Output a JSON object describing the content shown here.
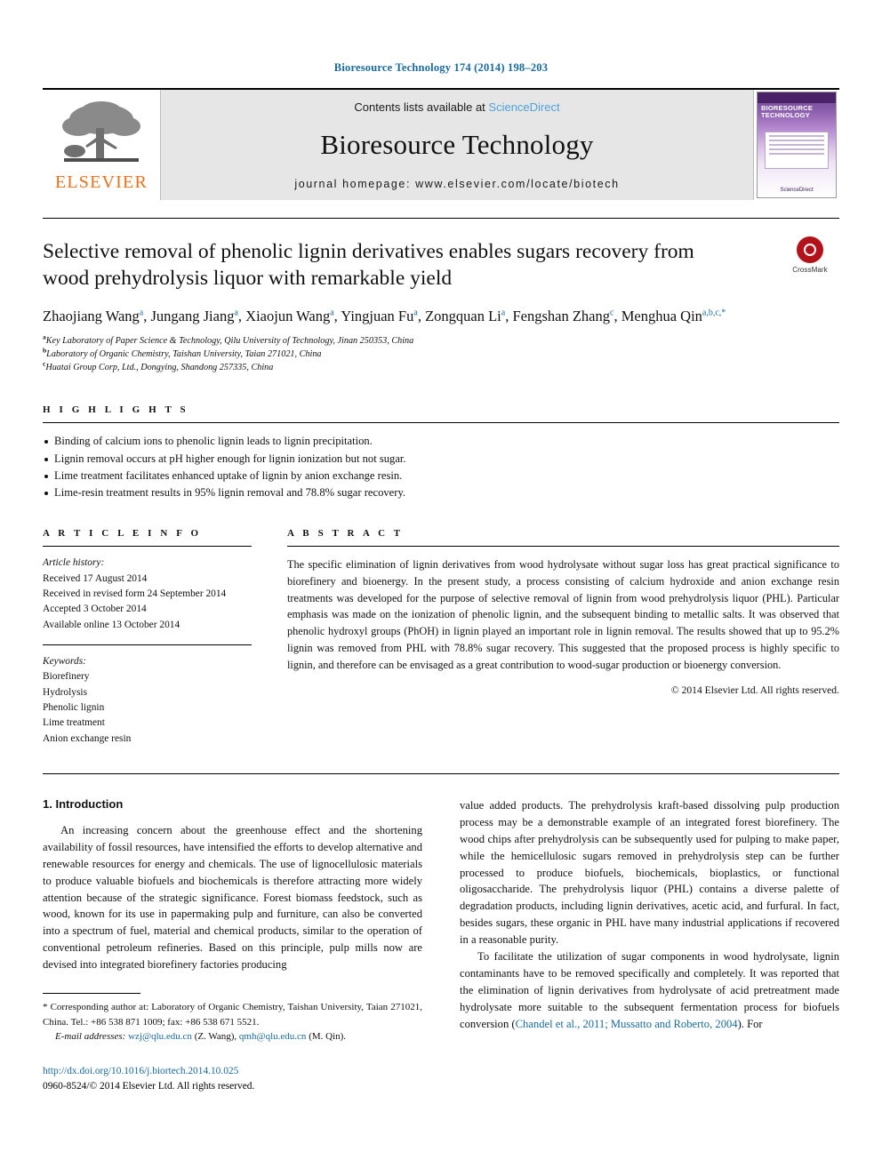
{
  "running_head": "Bioresource Technology 174 (2014) 198–203",
  "masthead": {
    "publisher_logo_text": "ELSEVIER",
    "contents_prefix": "Contents lists available at ",
    "contents_link": "ScienceDirect",
    "journal_title": "Bioresource Technology",
    "journal_homepage": "journal homepage: www.elsevier.com/locate/biotech",
    "cover": {
      "title": "BIORESOURCE TECHNOLOGY",
      "footer": "ScienceDirect"
    }
  },
  "article": {
    "title": "Selective removal of phenolic lignin derivatives enables sugars recovery from wood prehydrolysis liquor with remarkable yield",
    "crossmark_label": "CrossMark",
    "authors": [
      {
        "name": "Zhaojiang Wang",
        "marks": "a",
        "sep": ", "
      },
      {
        "name": "Jungang Jiang",
        "marks": "a",
        "sep": ", "
      },
      {
        "name": "Xiaojun Wang",
        "marks": "a",
        "sep": ", "
      },
      {
        "name": "Yingjuan Fu",
        "marks": "a",
        "sep": ", "
      },
      {
        "name": "Zongquan Li",
        "marks": "a",
        "sep": ", "
      },
      {
        "name": "Fengshan Zhang",
        "marks": "c",
        "sep": ", "
      },
      {
        "name": "Menghua Qin",
        "marks": "a,b,c,*",
        "sep": ""
      }
    ],
    "affiliations": [
      {
        "mark": "a",
        "text": "Key Laboratory of Paper Science & Technology, Qilu University of Technology, Jinan 250353, China"
      },
      {
        "mark": "b",
        "text": "Laboratory of Organic Chemistry, Taishan University, Taian 271021, China"
      },
      {
        "mark": "c",
        "text": "Huatai Group Corp, Ltd., Dongying, Shandong 257335, China"
      }
    ]
  },
  "highlights": {
    "heading": "H I G H L I G H T S",
    "items": [
      "Binding of calcium ions to phenolic lignin leads to lignin precipitation.",
      "Lignin removal occurs at pH higher enough for lignin ionization but not sugar.",
      "Lime treatment facilitates enhanced uptake of lignin by anion exchange resin.",
      "Lime-resin treatment results in 95% lignin removal and 78.8% sugar recovery."
    ]
  },
  "article_info": {
    "heading": "A R T I C L E    I N F O",
    "history_label": "Article history:",
    "history": [
      "Received 17 August 2014",
      "Received in revised form 24 September 2014",
      "Accepted 3 October 2014",
      "Available online 13 October 2014"
    ],
    "keywords_label": "Keywords:",
    "keywords": [
      "Biorefinery",
      "Hydrolysis",
      "Phenolic lignin",
      "Lime treatment",
      "Anion exchange resin"
    ]
  },
  "abstract": {
    "heading": "A B S T R A C T",
    "text": "The specific elimination of lignin derivatives from wood hydrolysate without sugar loss has great practical significance to biorefinery and bioenergy. In the present study, a process consisting of calcium hydroxide and anion exchange resin treatments was developed for the purpose of selective removal of lignin from wood prehydrolysis liquor (PHL). Particular emphasis was made on the ionization of phenolic lignin, and the subsequent binding to metallic salts. It was observed that phenolic hydroxyl groups (PhOH) in lignin played an important role in lignin removal. The results showed that up to 95.2% lignin was removed from PHL with 78.8% sugar recovery. This suggested that the proposed process is highly specific to lignin, and therefore can be envisaged as a great contribution to wood-sugar production or bioenergy conversion.",
    "copyright": "© 2014 Elsevier Ltd. All rights reserved."
  },
  "body": {
    "section_title": "1. Introduction",
    "left_paragraph": "An increasing concern about the greenhouse effect and the shortening availability of fossil resources, have intensified the efforts to develop alternative and renewable resources for energy and chemicals. The use of lignocellulosic materials to produce valuable biofuels and biochemicals is therefore attracting more widely attention because of the strategic significance. Forest biomass feedstock, such as wood, known for its use in papermaking pulp and furniture, can also be converted into a spectrum of fuel, material and chemical products, similar to the operation of conventional petroleum refineries. Based on this principle, pulp mills now are devised into integrated biorefinery factories producing",
    "right_paragraph_1": "value added products. The prehydrolysis kraft-based dissolving pulp production process may be a demonstrable example of an integrated forest biorefinery. The wood chips after prehydrolysis can be subsequently used for pulping to make paper, while the hemicellulosic sugars removed in prehydrolysis step can be further processed to produce biofuels, biochemicals, bioplastics, or functional oligosaccharide. The prehydrolysis liquor (PHL) contains a diverse palette of degradation products, including lignin derivatives, acetic acid, and furfural. In fact, besides sugars, these organic in PHL have many industrial applications if recovered in a reasonable purity.",
    "right_paragraph_2_before": "To facilitate the utilization of sugar components in wood hydrolysate, lignin contaminants have to be removed specifically and completely. It was reported that the elimination of lignin derivatives from hydrolysate of acid pretreatment made hydrolysate more suitable to the subsequent fermentation process for biofuels conversion (",
    "right_paragraph_2_citation": "Chandel et al., 2011; Mussatto and Roberto, 2004",
    "right_paragraph_2_after": "). For"
  },
  "footnote": {
    "corresponding": "* Corresponding author at: Laboratory of Organic Chemistry, Taishan University, Taian 271021, China. Tel.: +86 538 871 1009; fax: +86 538 671 5521.",
    "email_label": "E-mail addresses:",
    "email_1": "wzj@qlu.edu.cn",
    "email_1_owner": " (Z. Wang), ",
    "email_2": "qmh@qlu.edu.cn",
    "email_2_owner": " (M. Qin).",
    "doi": "http://dx.doi.org/10.1016/j.biortech.2014.10.025",
    "issn_line": "0960-8524/© 2014 Elsevier Ltd. All rights reserved."
  }
}
